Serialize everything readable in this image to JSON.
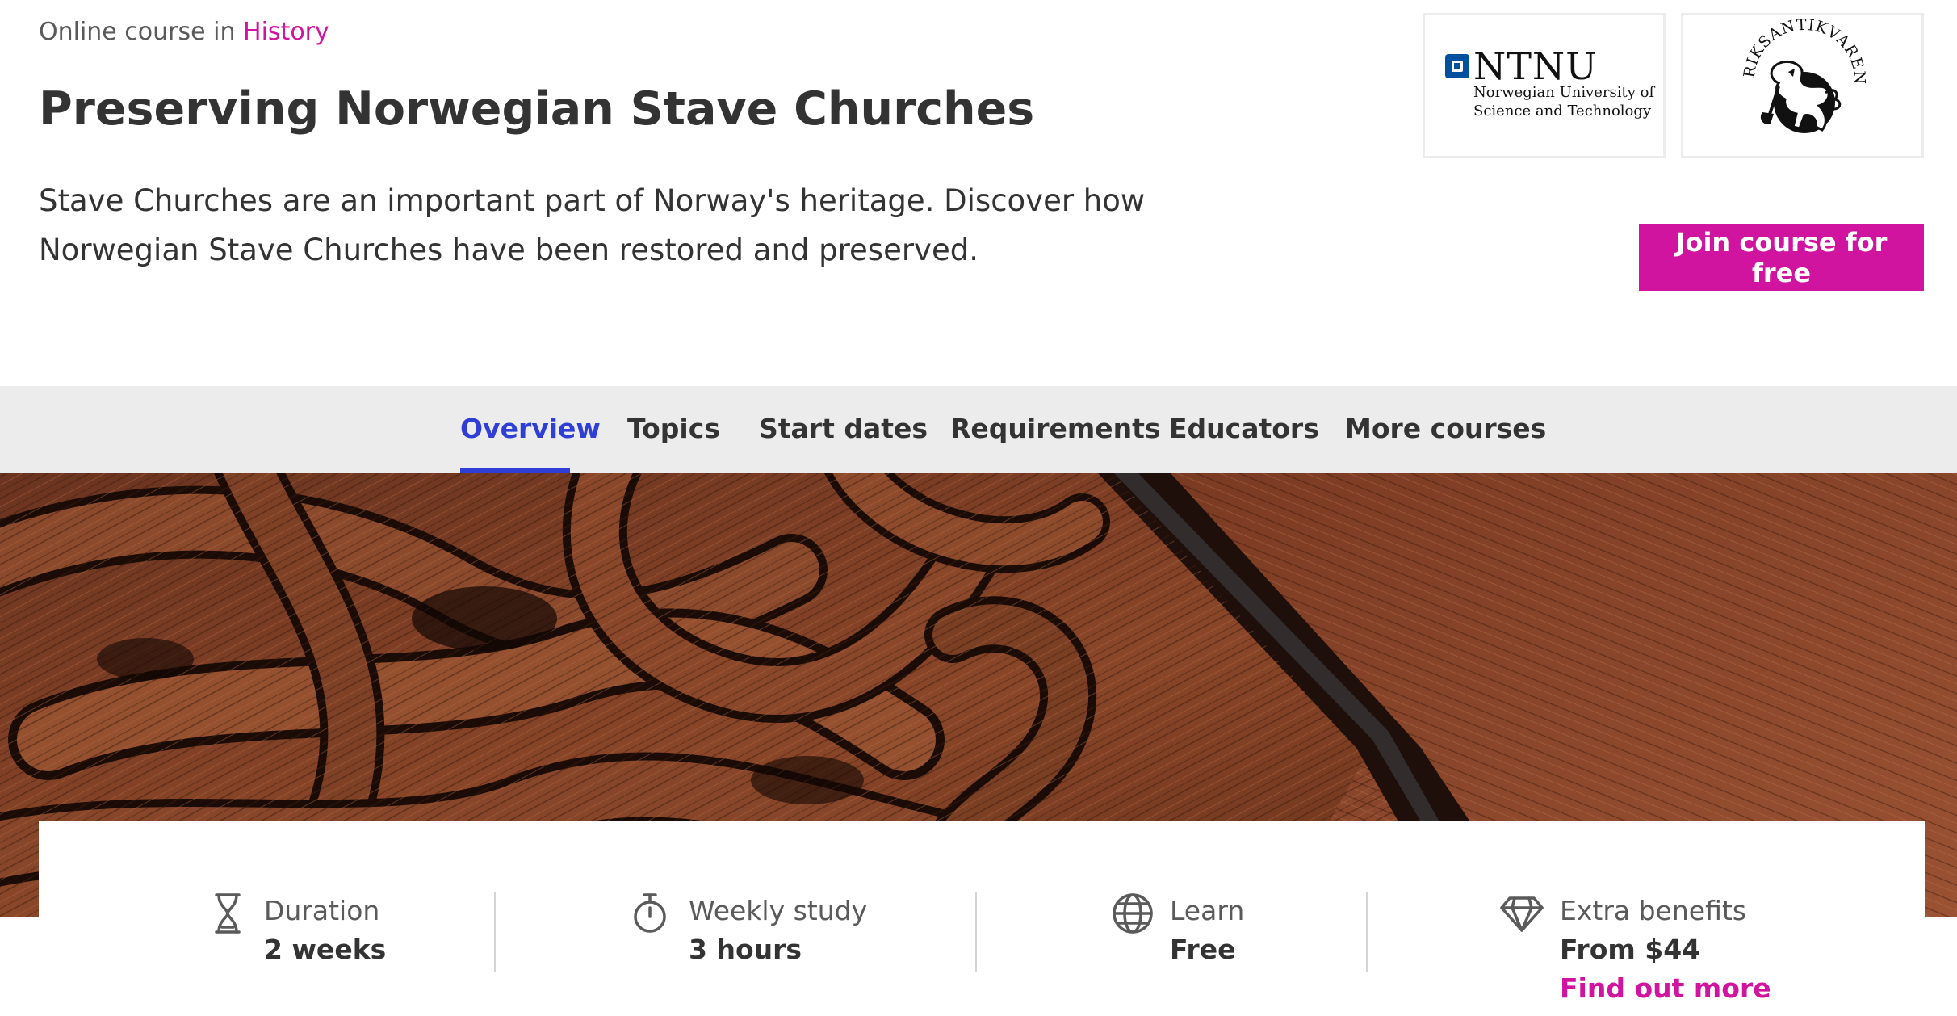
{
  "header": {
    "breadcrumb_prefix": "Online course in",
    "breadcrumb_link": "History",
    "title": "Preserving Norwegian Stave Churches",
    "description": "Stave Churches are an important part of Norway's heritage. Discover how Norwegian Stave Churches have been restored and preserved.",
    "join_button": "Join course for free",
    "accent_color": "#d1149f"
  },
  "partners": {
    "ntnu": {
      "name": "NTNU",
      "subtitle_line1": "Norwegian University of",
      "subtitle_line2": "Science and Technology",
      "brand_color": "#00509e"
    },
    "riksantikvaren": {
      "name": "RIKSANTIKVAREN",
      "icon": "lion-crest-icon"
    }
  },
  "nav": {
    "active_color": "#2f3fd6",
    "tabs": [
      {
        "label": "Overview",
        "active": true
      },
      {
        "label": "Topics",
        "active": false
      },
      {
        "label": "Start dates",
        "active": false
      },
      {
        "label": "Requirements",
        "active": false
      },
      {
        "label": "Educators",
        "active": false
      },
      {
        "label": "More courses",
        "active": false
      }
    ]
  },
  "hero": {
    "image": "carved-wood-stave-church-photo"
  },
  "info": {
    "duration": {
      "label": "Duration",
      "value": "2 weeks",
      "icon": "hourglass-icon"
    },
    "weekly_study": {
      "label": "Weekly study",
      "value": "3 hours",
      "icon": "stopwatch-icon"
    },
    "learn": {
      "label": "Learn",
      "value": "Free",
      "icon": "globe-icon"
    },
    "extra_benefits": {
      "label": "Extra benefits",
      "value": "From $44",
      "link": "Find out more",
      "icon": "diamond-icon"
    }
  }
}
